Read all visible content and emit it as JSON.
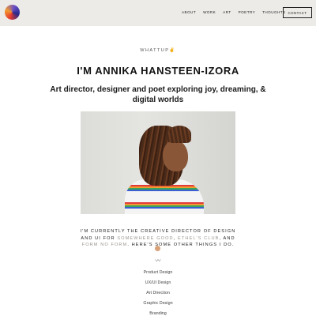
{
  "nav": {
    "items": [
      "ABOUT",
      "WORK",
      "ART",
      "POETRY",
      "THOUGHTS"
    ],
    "contact_label": "CONTACT"
  },
  "hero": {
    "eyebrow": "WHATTUP✌️",
    "title": "I'M ANNIKA HANSTEEN-IZORA",
    "subtitle": "Art director, designer and poet exploring joy, dreaming, & digital worlds"
  },
  "bio": {
    "text_1": "I'M CURRENTLY THE CREATIVE DIRECTOR OF DESIGN AND UI FOR ",
    "link_1": "SOMEWHERE GOOD",
    "text_2": ", ",
    "link_2": "ETHEL'S CLUB",
    "text_3": ", AND ",
    "link_3": "FORM NO FORM",
    "text_4": ". HERE'S SOME OTHER THINGS I DO."
  },
  "divider_glyph": "〰",
  "skills": [
    "Product Design",
    "UX/UI Design",
    "Art Direction",
    "Graphic Design",
    "Branding"
  ],
  "colors": {
    "header_bg": "#ecebe8",
    "link_gray": "#9a9590"
  }
}
